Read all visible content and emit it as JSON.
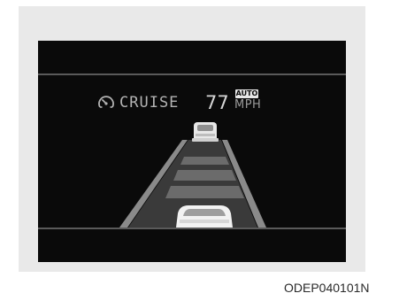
{
  "cruise_display": {
    "mode_label": "CRUISE",
    "set_speed": "77",
    "mode_badge": "AUTO",
    "speed_unit": "MPH",
    "icon": "cruise-speedometer-icon"
  },
  "figure_code": "ODEP040101N",
  "colors": {
    "screen_background": "#0a0a0a",
    "frame_background": "#e9e9e9",
    "text_dim": "#b3b3b3",
    "road_lane": "#6a6a6a"
  }
}
